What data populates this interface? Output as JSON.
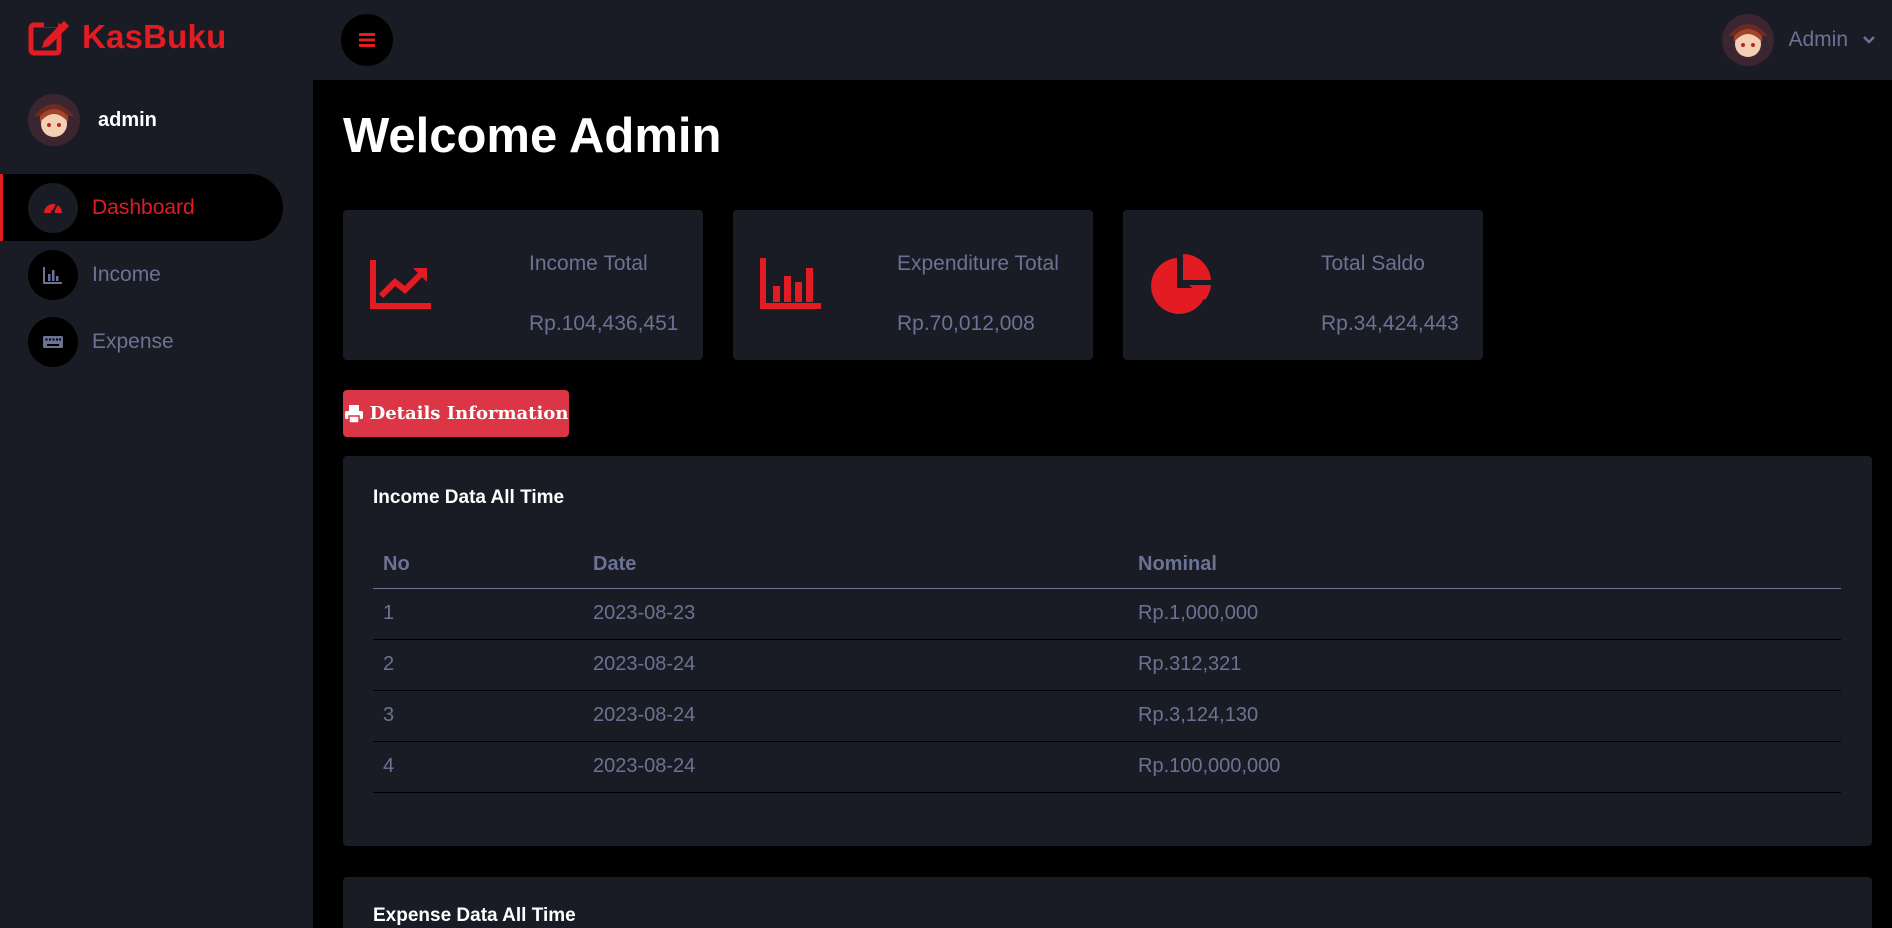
{
  "brand": {
    "name": "KasBuku",
    "icon": "edit-square-icon",
    "color": "#e31b23"
  },
  "sidebar": {
    "profile_name": "admin",
    "items": [
      {
        "label": "Dashboard",
        "icon": "tachometer-icon",
        "active": true
      },
      {
        "label": "Income",
        "icon": "bar-chart-icon",
        "active": false
      },
      {
        "label": "Expense",
        "icon": "keyboard-icon",
        "active": false
      }
    ]
  },
  "topbar": {
    "menu_icon": "hamburger-icon",
    "user_name": "Admin",
    "dropdown_icon": "chevron-down-icon"
  },
  "main": {
    "welcome": "Welcome Admin",
    "cards": [
      {
        "label": "Income Total",
        "value": "Rp.104,436,451",
        "icon": "trend-up-icon"
      },
      {
        "label": "Expenditure Total",
        "value": "Rp.70,012,008",
        "icon": "bar-chart-icon"
      },
      {
        "label": "Total Saldo",
        "value": "Rp.34,424,443",
        "icon": "pie-chart-icon"
      }
    ],
    "details_button": "Details Information",
    "income_panel": {
      "title": "Income Data All Time",
      "columns": [
        "No",
        "Date",
        "Nominal"
      ],
      "rows": [
        [
          "1",
          "2023-08-23",
          "Rp.1,000,000"
        ],
        [
          "2",
          "2023-08-24",
          "Rp.312,321"
        ],
        [
          "3",
          "2023-08-24",
          "Rp.3,124,130"
        ],
        [
          "4",
          "2023-08-24",
          "Rp.100,000,000"
        ]
      ]
    },
    "expense_panel": {
      "title": "Expense Data All Time"
    }
  },
  "colors": {
    "accent": "#e31b23",
    "panel": "#191c24",
    "muted": "#6c7293",
    "button": "#dc3545"
  }
}
